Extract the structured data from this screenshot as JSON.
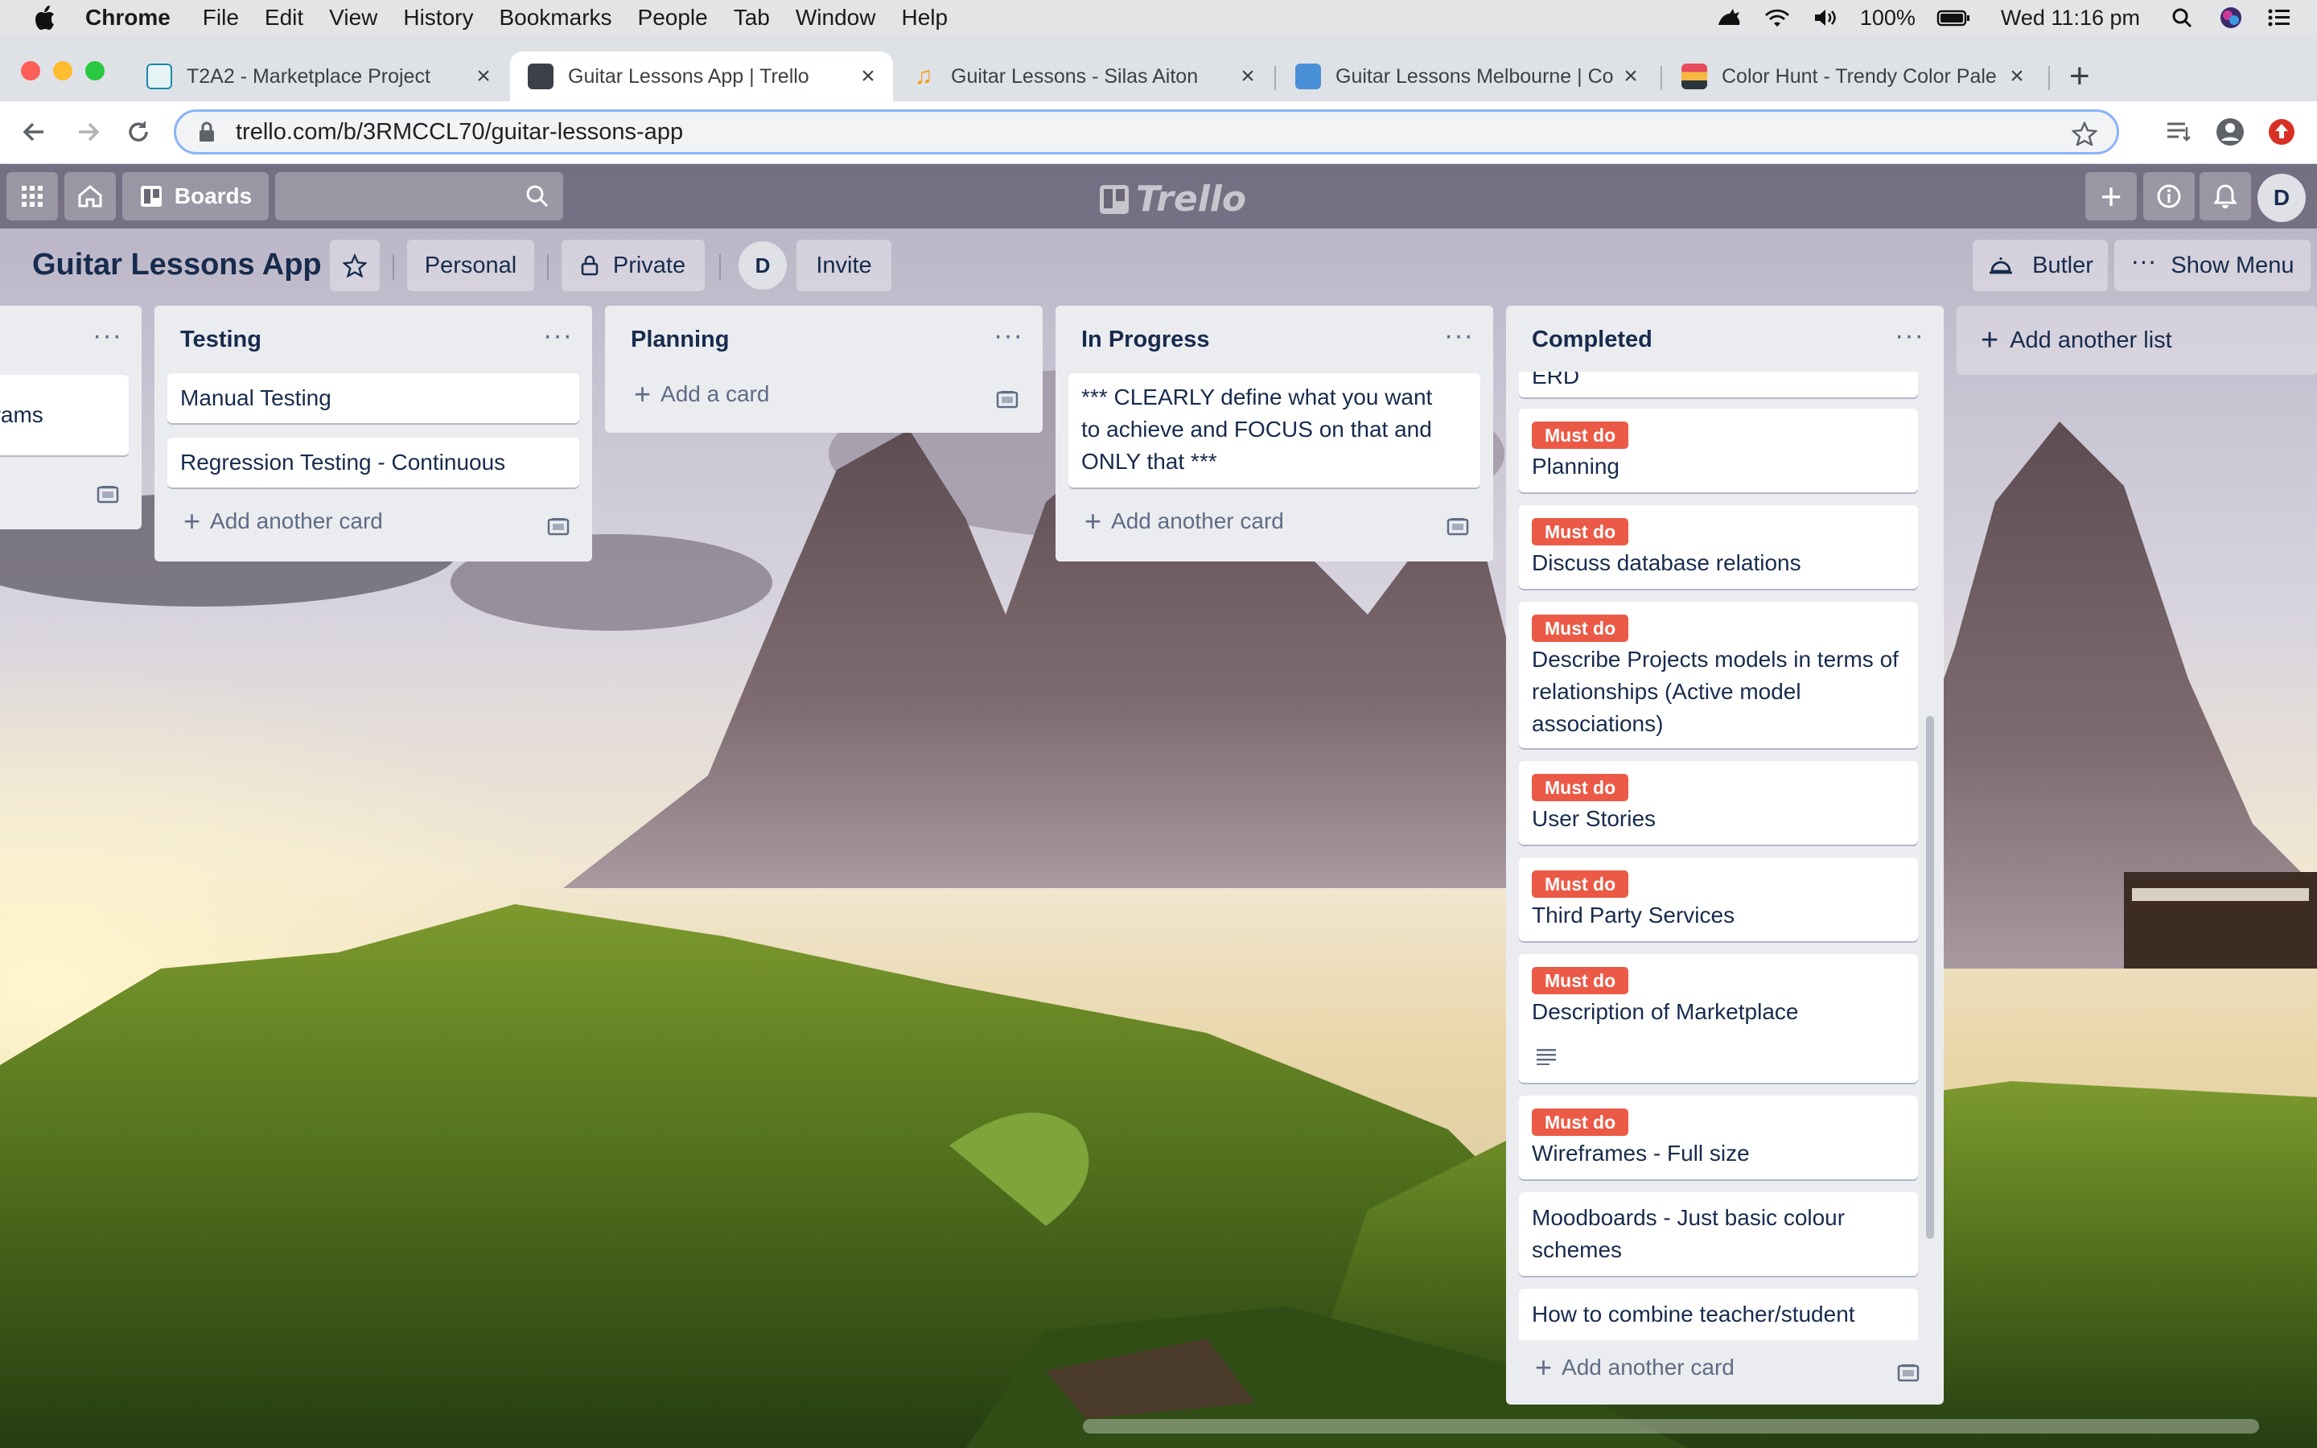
{
  "menubar": {
    "app": "Chrome",
    "items": [
      "File",
      "Edit",
      "View",
      "History",
      "Bookmarks",
      "People",
      "Tab",
      "Window",
      "Help"
    ],
    "battery": "100%",
    "clock": "Wed 11:16 pm"
  },
  "tabs": [
    {
      "title": "T2A2 - Marketplace Project",
      "favicon": "marketplace-favicon"
    },
    {
      "title": "Guitar Lessons App | Trello",
      "favicon": "trello-favicon"
    },
    {
      "title": "Guitar Lessons - Silas Aiton",
      "favicon": "music-note-favicon"
    },
    {
      "title": "Guitar Lessons Melbourne | Co",
      "favicon": "compass-favicon"
    },
    {
      "title": "Color Hunt - Trendy Color Pale",
      "favicon": "color-hunt-favicon"
    }
  ],
  "address": {
    "url": "trello.com/b/3RMCCL70/guitar-lessons-app"
  },
  "trello": {
    "boards_label": "Boards",
    "logo_text": "Trello",
    "avatar_initial": "D"
  },
  "board": {
    "title": "Guitar Lessons App",
    "team": "Personal",
    "visibility": "Private",
    "member_initial": "D",
    "invite": "Invite",
    "butler": "Butler",
    "show_menu": "Show Menu",
    "add_list": "Add another list"
  },
  "lists": {
    "partial": {
      "card_fragment": "arams"
    },
    "testing": {
      "title": "Testing",
      "cards": [
        "Manual Testing",
        "Regression Testing - Continuous"
      ],
      "add": "Add another card"
    },
    "planning": {
      "title": "Planning",
      "add": "Add a card"
    },
    "in_progress": {
      "title": "In Progress",
      "cards": [
        "*** CLEARLY define what you want to achieve and FOCUS on that and ONLY that ***"
      ],
      "add": "Add another card"
    },
    "completed": {
      "title": "Completed",
      "label": "Must do",
      "cards": [
        "ERD",
        "Planning",
        "Discuss database relations",
        "Describe Projects models in terms of relationships (Active model associations)",
        "User Stories",
        "Third Party Services",
        "Description of Marketplace",
        "Wireframes - Full size",
        "Moodboards - Just basic colour schemes",
        "How to combine teacher/student"
      ],
      "add": "Add another card"
    }
  },
  "colors": {
    "label_red": "#eb5a46",
    "list_bg": "#ebecf0",
    "text_dark": "#172b4d"
  }
}
